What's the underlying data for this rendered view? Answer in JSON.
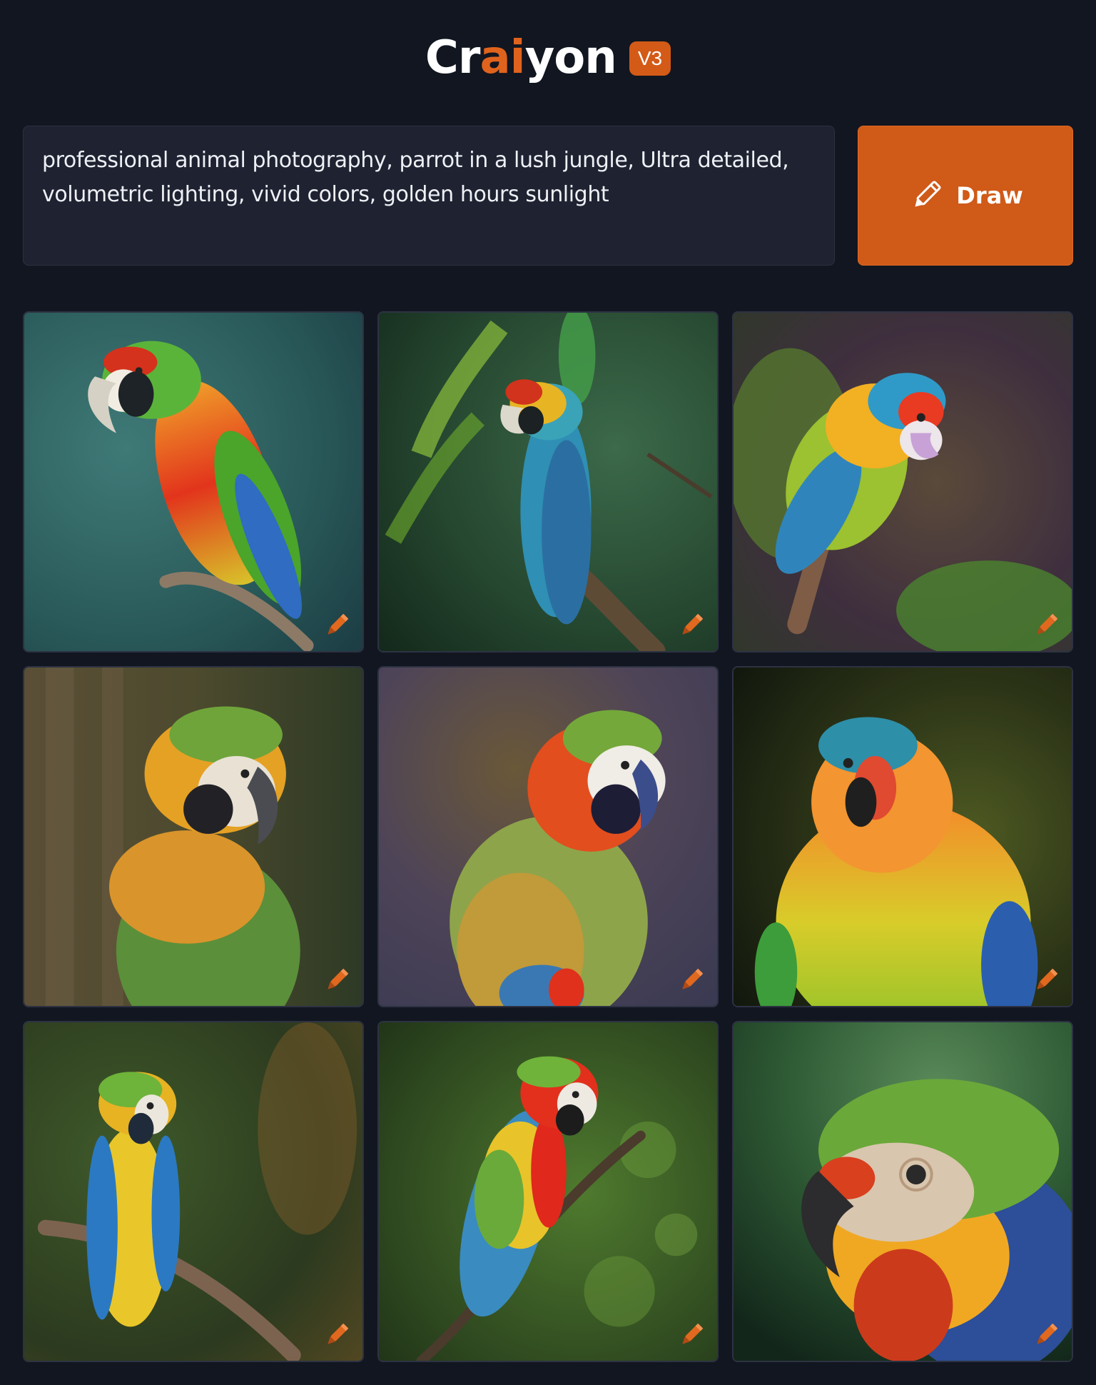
{
  "app": {
    "logo": {
      "part1": "Cr",
      "part2": "ai",
      "part3": "yon"
    },
    "version_badge": "V3",
    "accent_color": "#d35a17"
  },
  "prompt": {
    "value": "professional animal photography, parrot in a lush jungle, Ultra detailed, volumetric lighting, vivid colors, golden hours sunlight"
  },
  "draw_button": {
    "label": "Draw",
    "icon": "pencil-icon"
  },
  "results": {
    "tiles": [
      {
        "subject": "parrot on branch, teal background",
        "icon": "edit-pencil-icon"
      },
      {
        "subject": "blue parrot on branch, green jungle leaves",
        "icon": "edit-pencil-icon"
      },
      {
        "subject": "multicolor parrot, purple-green jungle",
        "icon": "edit-pencil-icon"
      },
      {
        "subject": "macaw portrait, olive background",
        "icon": "edit-pencil-icon"
      },
      {
        "subject": "macaw, purple background",
        "icon": "edit-pencil-icon"
      },
      {
        "subject": "green-orange parrot, dark background",
        "icon": "edit-pencil-icon"
      },
      {
        "subject": "yellow-blue macaw on branch",
        "icon": "edit-pencil-icon"
      },
      {
        "subject": "scarlet macaw on branch, green bokeh",
        "icon": "edit-pencil-icon"
      },
      {
        "subject": "macaw close-up head",
        "icon": "edit-pencil-icon"
      }
    ]
  }
}
